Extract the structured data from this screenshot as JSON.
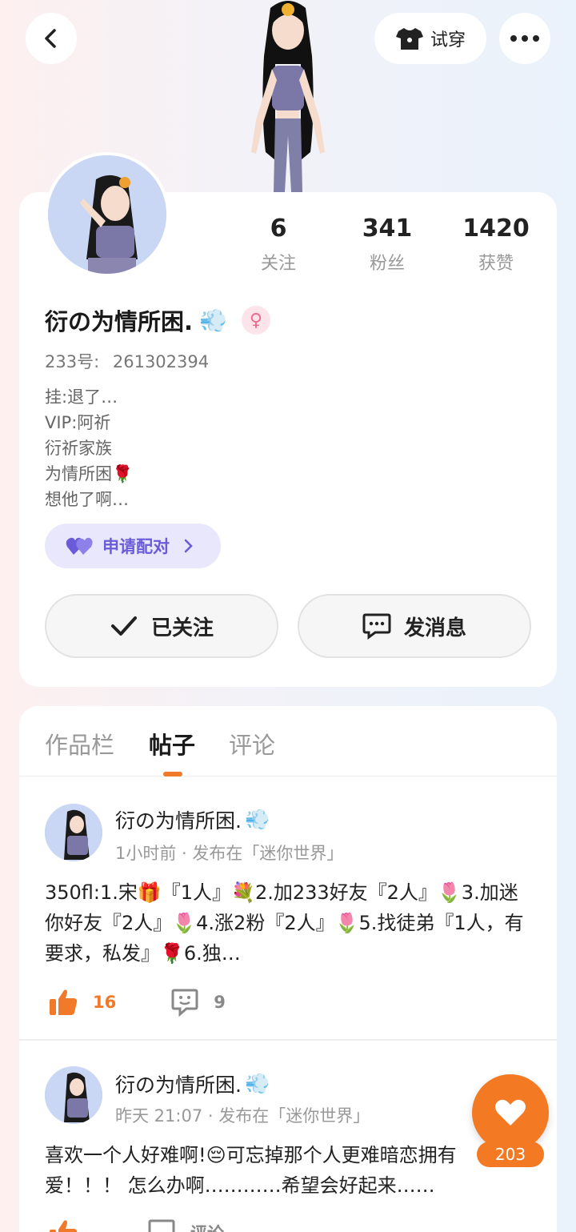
{
  "header": {
    "try_on_label": "试穿",
    "colors": {
      "accent": "#f37a22",
      "pair_purple": "#6a5bd8"
    }
  },
  "profile": {
    "nickname": "衍の为情所困.",
    "nickname_emoji": "💨",
    "gender_icon": "female-icon",
    "uid_label": "233号:",
    "uid_value": "261302394",
    "stats": [
      {
        "value": "6",
        "label": "关注"
      },
      {
        "value": "341",
        "label": "粉丝"
      },
      {
        "value": "1420",
        "label": "获赞"
      }
    ],
    "bio": [
      "挂:退了…",
      "VIP:阿祈",
      "衍祈家族",
      "为情所困🌹",
      "想他了啊…"
    ],
    "pair_button": "申请配对",
    "follow_button": "已关注",
    "message_button": "发消息"
  },
  "tabs": [
    {
      "label": "作品栏",
      "active": false
    },
    {
      "label": "帖子",
      "active": true
    },
    {
      "label": "评论",
      "active": false
    }
  ],
  "posts": [
    {
      "author": "衍の为情所困.",
      "author_emoji": "💨",
      "meta": "1小时前 · 发布在「迷你世界」",
      "text": "350fl:1.宋🎁『1人』💐2.加233好友『2人』🌷3.加迷你好友『2人』🌷4.涨2粉『2人』🌷5.找徒弟『1人，有要求，私发』🌹6.独…",
      "likes": "16",
      "comments": "9"
    },
    {
      "author": "衍の为情所困.",
      "author_emoji": "💨",
      "meta": "昨天 21:07 · 发布在「迷你世界」",
      "text": "喜欢一个人好难啊!😔可忘掉那个人更难暗恋拥有爱！！！ 怎么办啊…………希望会好起来……",
      "likes": "",
      "comments": "评论"
    }
  ],
  "fab": {
    "count": "203"
  }
}
